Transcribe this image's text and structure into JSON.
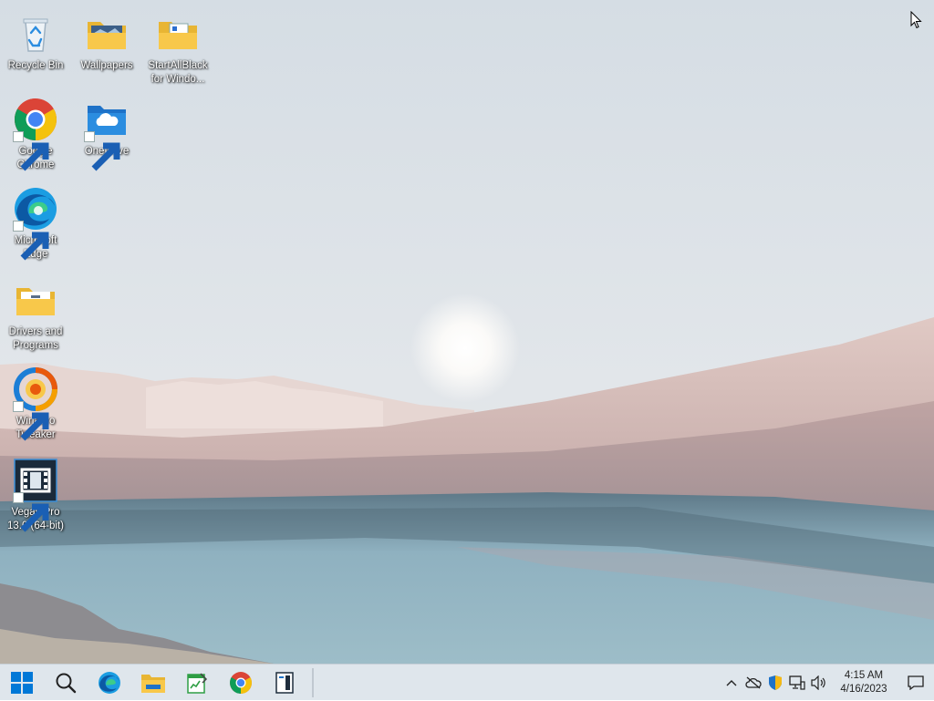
{
  "desktop": {
    "icons": [
      {
        "label": "Recycle Bin",
        "icon": "recycle-bin-icon"
      },
      {
        "label": "Wallpapers",
        "icon": "folder-icon"
      },
      {
        "label": "StartAllBlack for Windo...",
        "icon": "folder-icon"
      },
      {
        "label": "Google Chrome",
        "icon": "chrome-icon",
        "shortcut": true
      },
      {
        "label": "OneDrive",
        "icon": "onedrive-folder-icon",
        "shortcut": true
      },
      {
        "label": "Microsoft Edge",
        "icon": "edge-icon",
        "shortcut": true
      },
      {
        "label": "Drivers and Programs",
        "icon": "folder-icon"
      },
      {
        "label": "Winaero Tweaker",
        "icon": "winaero-icon",
        "shortcut": true
      },
      {
        "label": "Vegas Pro 13.0 (64-bit)",
        "icon": "vegas-icon",
        "shortcut": true
      }
    ]
  },
  "taskbar": {
    "buttons": [
      "start-button",
      "search-button",
      "edge-button",
      "file-explorer-button",
      "notepad-button",
      "chrome-button",
      "app-button"
    ],
    "tray": {
      "icons": [
        "show-hidden-icons",
        "onedrive-offline-icon",
        "security-icon",
        "network-icon",
        "volume-icon"
      ],
      "time": "4:15 AM",
      "date": "4/16/2023"
    }
  },
  "colors": {
    "taskbar": "#dfe6ec",
    "windows_blue": "#0078d7",
    "folder_yellow": "#f8c84a"
  }
}
